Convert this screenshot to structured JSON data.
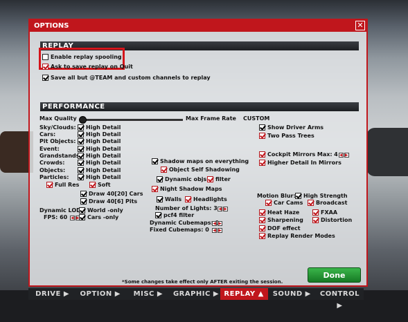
{
  "window": {
    "title": "OPTIONS",
    "close_glyph": "✕"
  },
  "replay": {
    "header": "REPLAY",
    "enable_spooling": "Enable replay spooling",
    "ask_to_save": "Ask to save replay on Quit",
    "save_all": "Save all but @TEAM and custom channels to replay"
  },
  "performance": {
    "header": "PERFORMANCE",
    "max_quality": "Max Quality",
    "max_frame_rate": "Max Frame Rate",
    "custom": "CUSTOM",
    "detail_rows": [
      {
        "label": "Sky/Clouds:",
        "value": "High Detail"
      },
      {
        "label": "Cars:",
        "value": "High Detail"
      },
      {
        "label": "Pit Objects:",
        "value": "High Detail"
      },
      {
        "label": "Event:",
        "value": "High Detail"
      },
      {
        "label": "Grandstands:",
        "value": "High Detail"
      },
      {
        "label": "Crowds:",
        "value": "High Detail"
      },
      {
        "label": "Objects:",
        "value": "High Detail"
      },
      {
        "label": "Particles:",
        "value": "High Detail"
      }
    ],
    "full_res": "Full Res",
    "soft": "Soft",
    "draw_cars": "Draw 40[20] Cars",
    "draw_pits": "Draw 40[6] Pits",
    "dynamic_lod": "Dynamic LOD",
    "world_only": "World -only",
    "fps_label": "FPS: 60",
    "cars_only": "Cars -only",
    "shadow_maps_everything": "Shadow maps on everything",
    "object_self_shadowing": "Object Self Shadowing",
    "dynamic_objs": "Dynamic objs",
    "filter": "filter",
    "night_shadow_maps": "Night Shadow Maps",
    "walls": "Walls",
    "headlights": "Headlights",
    "number_of_lights": "Number of Lights: 3",
    "pcf4_filter": "pcf4 filter",
    "dynamic_cubemaps": "Dynamic Cubemaps: 0",
    "fixed_cubemaps": "Fixed Cubemaps: 0",
    "show_driver_arms": "Show Driver Arms",
    "two_pass_trees": "Two Pass Trees",
    "cockpit_mirrors": "Cockpit Mirrors",
    "max_label": "Max:",
    "max_value": "4",
    "higher_detail_mirrors": "Higher Detail In Mirrors",
    "motion_blur": "Motion Blur:",
    "high_strength": "High Strength",
    "car_cams": "Car Cams",
    "broadcast": "Broadcast",
    "heat_haze": "Heat Haze",
    "fxaa": "FXAA",
    "sharpening": "Sharpening",
    "distortion": "Distortion",
    "dof_effect": "DOF effect",
    "replay_render_modes": "Replay Render Modes"
  },
  "footer": {
    "note": "*Some changes take effect only AFTER exiting the session.",
    "done": "Done"
  },
  "tabs": [
    {
      "label": "DRIVE ▶"
    },
    {
      "label": "OPTION ▶"
    },
    {
      "label": "MISC ▶"
    },
    {
      "label": "GRAPHIC ▶"
    },
    {
      "label": "REPLAY ▲"
    },
    {
      "label": "SOUND ▶"
    },
    {
      "label": "CONTROL ▶"
    }
  ],
  "colors": {
    "accent": "#c0161c",
    "done_green": "#2a9a3a"
  }
}
